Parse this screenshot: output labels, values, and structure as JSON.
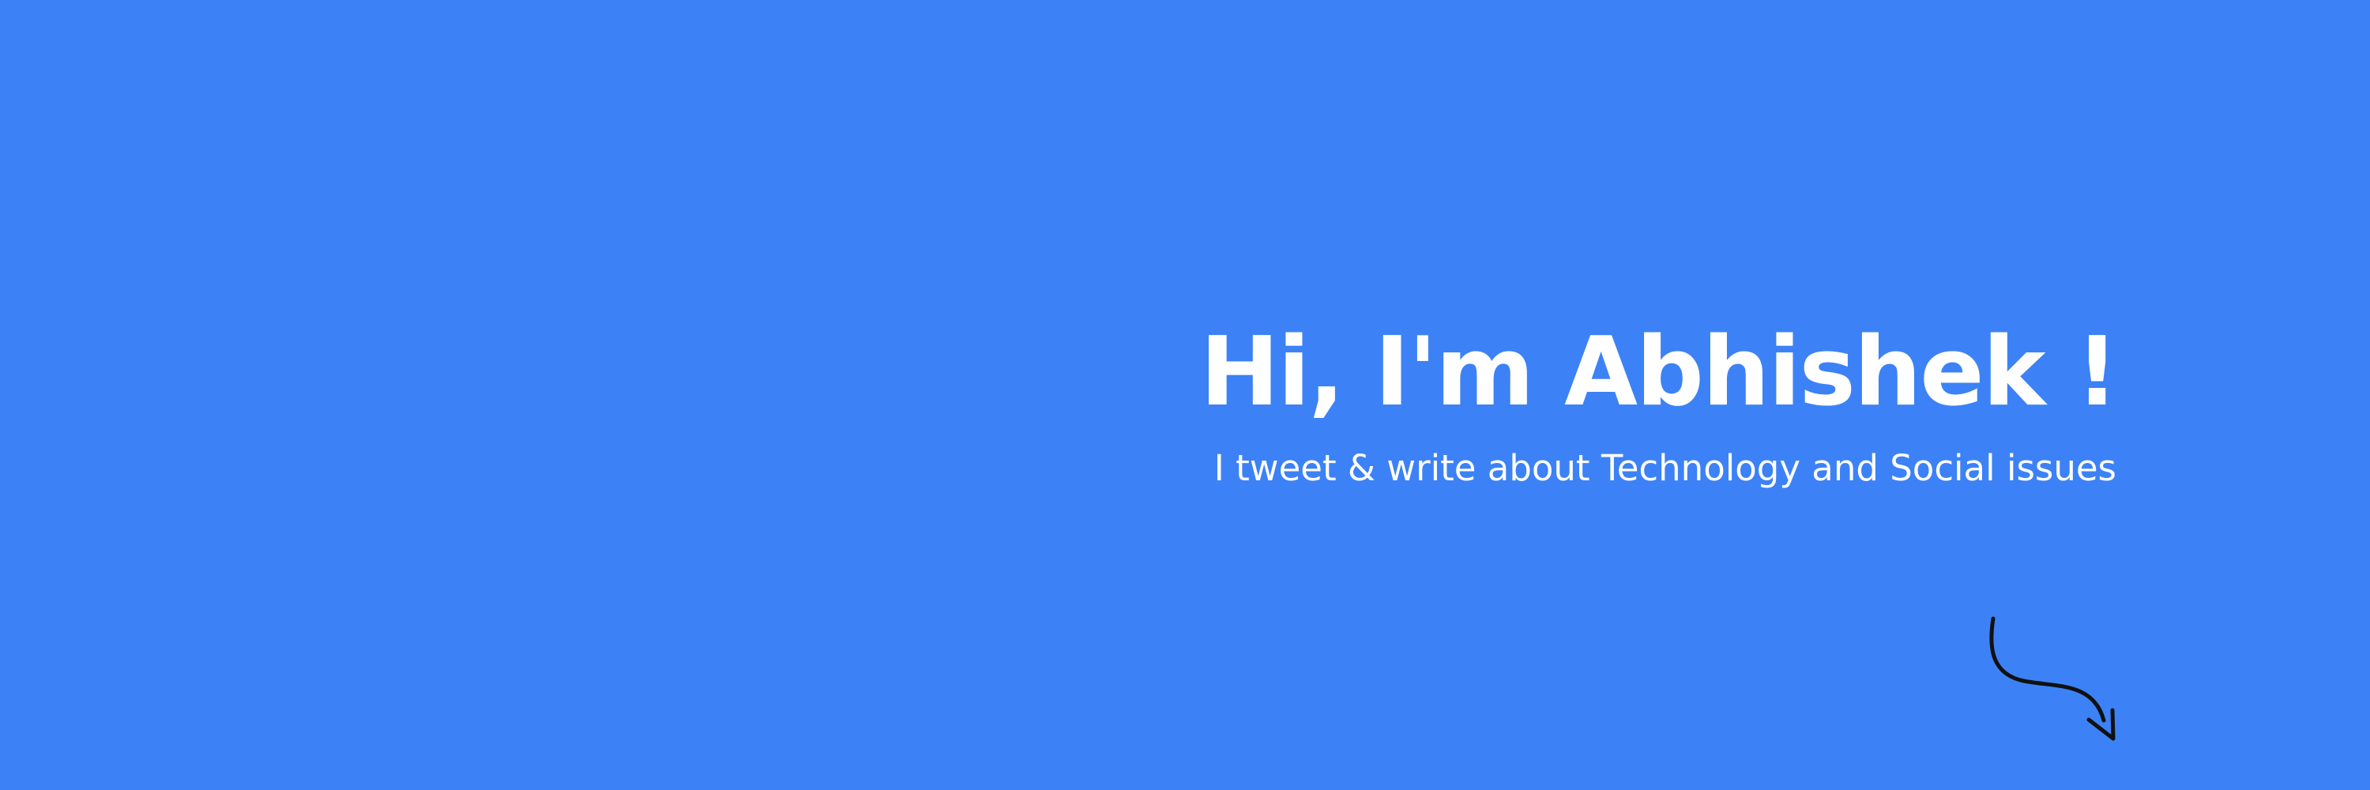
{
  "banner": {
    "background_color": "#3C82F6",
    "text_color": "#FFFFFF",
    "headline": "Hi, I'm Abhishek !",
    "tagline": "I tweet & write about Technology and Social issues",
    "arrow_icon": "curved-arrow-down-right"
  }
}
